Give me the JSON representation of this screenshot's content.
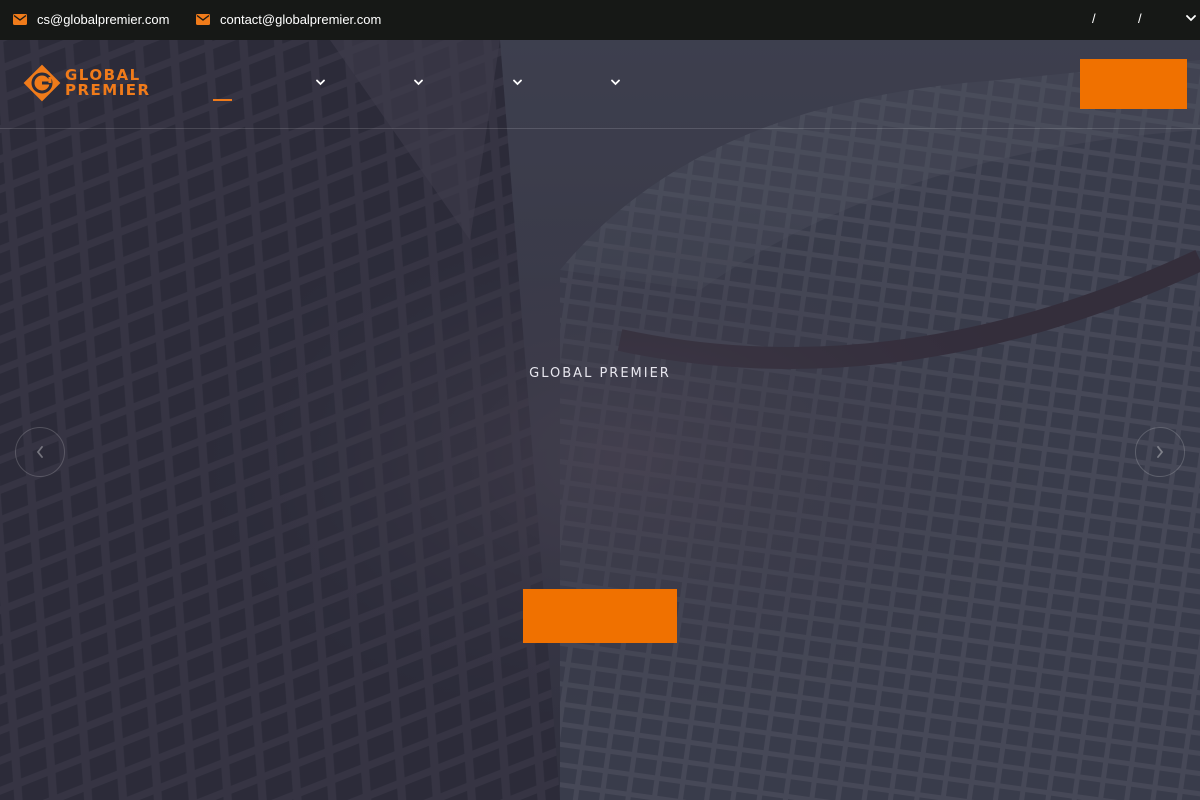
{
  "topbar": {
    "emails": [
      {
        "text": "cs@globalpremier.com",
        "icon": "envelope-icon"
      },
      {
        "text": "contact@globalpremier.com",
        "icon": "envelope-icon"
      }
    ],
    "lang_separators": [
      "/",
      "/"
    ],
    "lang_dropdown_icon": "chevron-down-icon"
  },
  "brand": {
    "line1": "GLOBAL",
    "line2": "PREMIER",
    "logo_icon": "global-premier-logo-icon"
  },
  "slider": {
    "eyebrow": "GLOBAL PREMIER",
    "prev_icon": "chevron-left-icon",
    "next_icon": "chevron-right-icon"
  },
  "colors": {
    "accent": "#f07100",
    "topbar": "#161816",
    "overlay": "#2e2f3e"
  }
}
